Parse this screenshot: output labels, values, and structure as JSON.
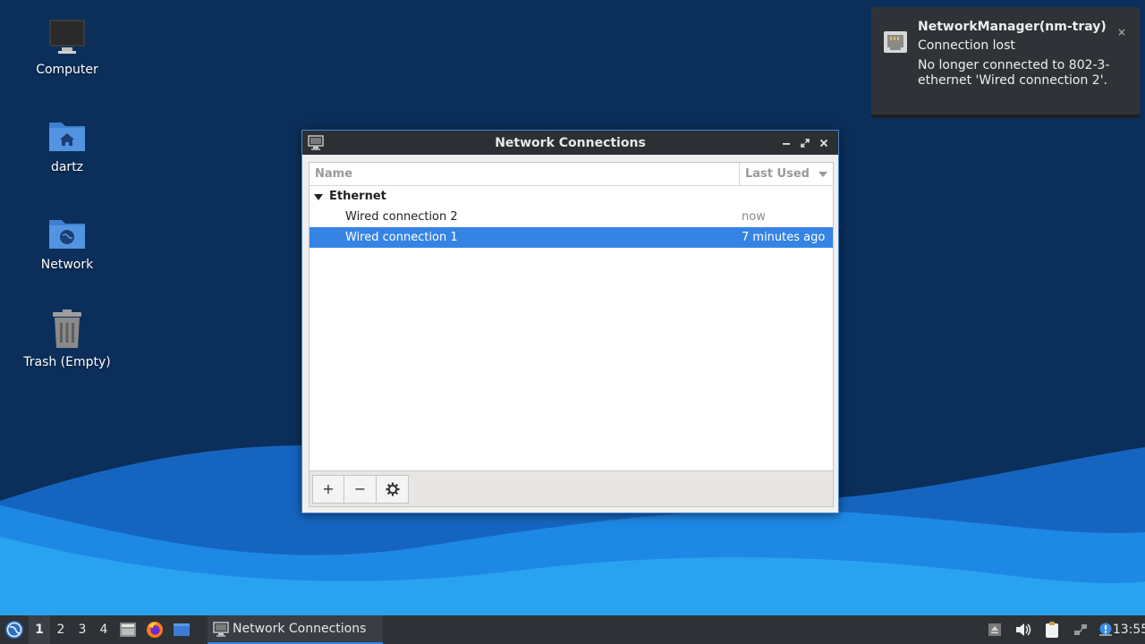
{
  "desktop": {
    "icons": [
      {
        "label": "Computer",
        "icon": "computer-icon"
      },
      {
        "label": "dartz",
        "icon": "home-folder-icon"
      },
      {
        "label": "Network",
        "icon": "network-folder-icon"
      },
      {
        "label": "Trash (Empty)",
        "icon": "trash-icon"
      }
    ]
  },
  "notification": {
    "title": "NetworkManager(nm-tray)",
    "summary": "Connection lost",
    "body": "No longer connected to 802-3-ethernet 'Wired connection 2'.",
    "close_label": "×",
    "icon": "ethernet-icon"
  },
  "window": {
    "title": "Network Connections",
    "icon": "network-connections-icon",
    "columns": {
      "name": "Name",
      "last_used": "Last Used"
    },
    "groups": [
      {
        "label": "Ethernet",
        "connections": [
          {
            "name": "Wired connection 2",
            "last_used": "now",
            "selected": false
          },
          {
            "name": "Wired connection 1",
            "last_used": "7 minutes ago",
            "selected": true
          }
        ]
      }
    ],
    "buttons": {
      "add": "+",
      "remove": "−",
      "settings": "gear-icon"
    }
  },
  "taskbar": {
    "workspaces": [
      "1",
      "2",
      "3",
      "4"
    ],
    "active_workspace": "1",
    "task_label": "Network Connections",
    "clock": "13:55"
  },
  "colors": {
    "accent": "#3584e4",
    "titlebar": "#2c2f33",
    "taskbar": "#2e3136",
    "desktop": "#0b2f5a"
  }
}
